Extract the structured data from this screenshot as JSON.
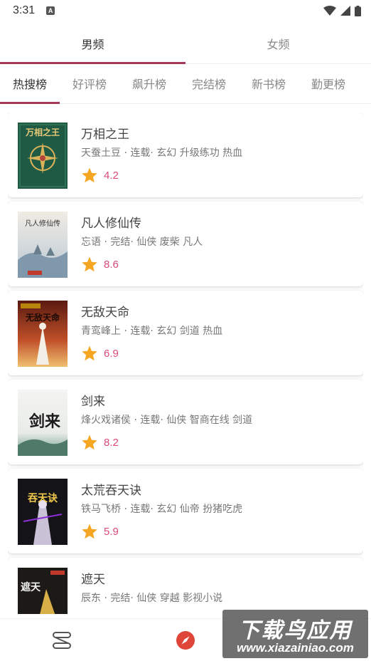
{
  "status_bar": {
    "time": "3:31",
    "notification": "A"
  },
  "gender_tabs": [
    {
      "label": "男频",
      "active": true
    },
    {
      "label": "女频",
      "active": false
    }
  ],
  "rank_tabs": [
    {
      "label": "热搜榜",
      "active": true
    },
    {
      "label": "好评榜",
      "active": false
    },
    {
      "label": "飙升榜",
      "active": false
    },
    {
      "label": "完结榜",
      "active": false
    },
    {
      "label": "新书榜",
      "active": false
    },
    {
      "label": "勤更榜",
      "active": false
    }
  ],
  "books": [
    {
      "title": "万相之王",
      "meta": "天蚕土豆 · 连载· 玄幻 升级练功 热血",
      "rating": "4.2",
      "cover_text": "万相之王"
    },
    {
      "title": "凡人修仙传",
      "meta": "忘语 · 完结· 仙侠 废柴 凡人",
      "rating": "8.6",
      "cover_text": "凡人修仙传"
    },
    {
      "title": "无敌天命",
      "meta": "青鸾峰上 · 连载· 玄幻 剑道 热血",
      "rating": "6.9",
      "cover_text": "无敌天命"
    },
    {
      "title": "剑来",
      "meta": "烽火戏诸侯 · 连载· 仙侠 智商在线 剑道",
      "rating": "8.2",
      "cover_text": "剑来"
    },
    {
      "title": "太荒吞天诀",
      "meta": "铁马飞桥 · 连载· 玄幻 仙帝 扮猪吃虎",
      "rating": "5.9",
      "cover_text": "吞天诀"
    },
    {
      "title": "遮天",
      "meta": "辰东 · 完结· 仙侠 穿越 影视小说",
      "rating": "",
      "cover_text": "遮天"
    }
  ],
  "bottom_nav": [
    {
      "icon": "bookshelf-icon"
    },
    {
      "icon": "compass-icon"
    }
  ],
  "watermark": {
    "main": "下载鸟应用",
    "sub": "www.xiazainiao.com"
  },
  "colors": {
    "accent": "#a23a58",
    "rating": "#d94a78",
    "star": "#f5a623",
    "compass": "#e0453a"
  }
}
